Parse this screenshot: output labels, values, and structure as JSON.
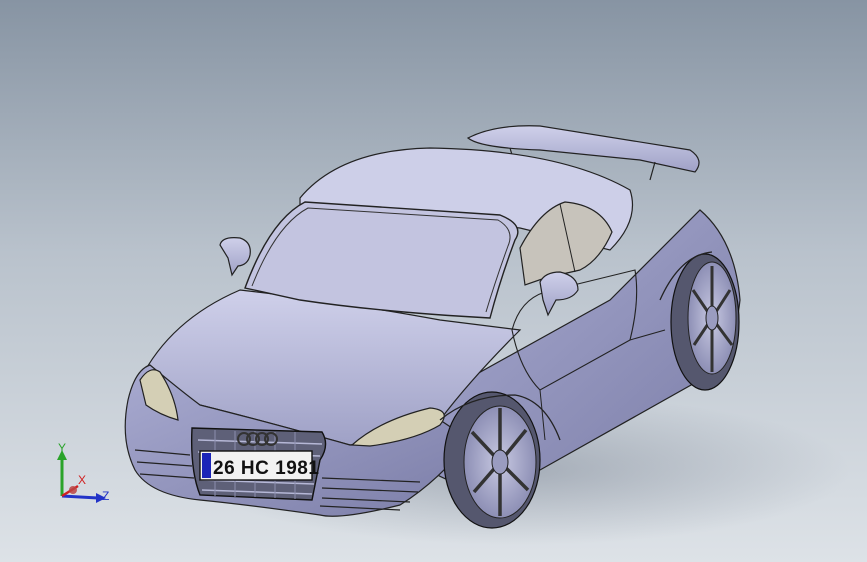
{
  "viewport": {
    "model": {
      "name": "sports-car",
      "license_plate": "26 HC 1981",
      "body_color": "#b7b9dc",
      "glass_color": "#c7c3bb"
    },
    "triad": {
      "y_label": "Y",
      "x_label": "X",
      "z_label": "Z",
      "y_color": "#2aa32a",
      "x_color": "#d02020",
      "z_color": "#2233c8"
    }
  }
}
